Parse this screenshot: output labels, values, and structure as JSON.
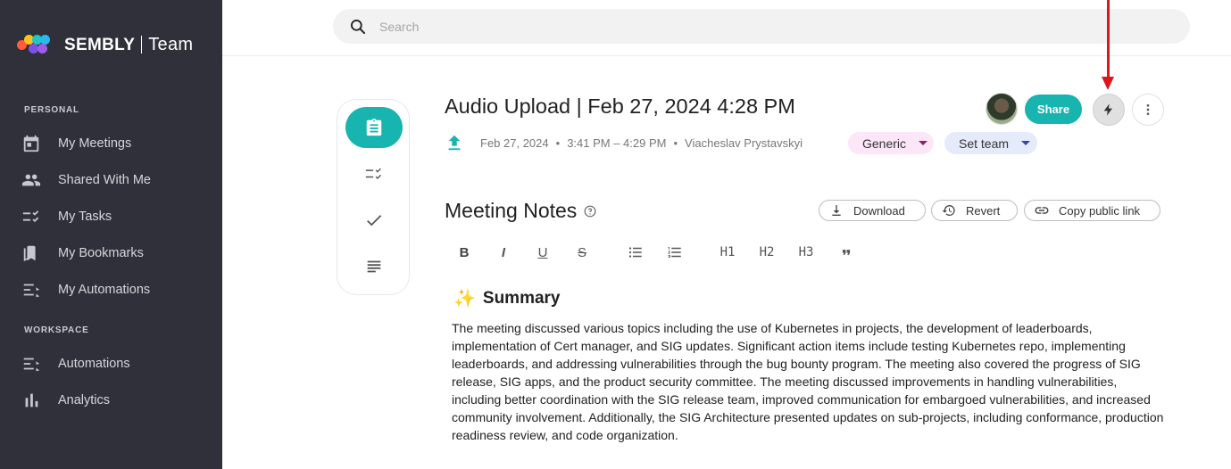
{
  "app": {
    "brand": "SEMBLY",
    "brand_suffix": "Team"
  },
  "sidebar": {
    "personal_label": "PERSONAL",
    "workspace_label": "WORKSPACE",
    "personal_items": [
      {
        "label": "My Meetings",
        "icon": "calendar-icon"
      },
      {
        "label": "Shared With Me",
        "icon": "people-icon"
      },
      {
        "label": "My Tasks",
        "icon": "tasks-icon"
      },
      {
        "label": "My Bookmarks",
        "icon": "bookmark-icon"
      },
      {
        "label": "My Automations",
        "icon": "automation-icon"
      }
    ],
    "workspace_items": [
      {
        "label": "Automations",
        "icon": "automation-icon"
      },
      {
        "label": "Analytics",
        "icon": "bar-chart-icon"
      }
    ]
  },
  "search": {
    "placeholder": "Search",
    "value": ""
  },
  "meeting": {
    "title": "Audio Upload | Feb 27, 2024 4:28 PM",
    "date": "Feb 27, 2024",
    "time_range": "3:41 PM – 4:29 PM",
    "owner": "Viacheslav Prystavskyi",
    "separator": "•",
    "type_chip": "Generic",
    "team_chip": "Set team",
    "share_label": "Share"
  },
  "notes": {
    "title": "Meeting Notes",
    "download_label": "Download",
    "revert_label": "Revert",
    "copy_link_label": "Copy public link",
    "format_toolbar": [
      "B",
      "I",
      "U",
      "S",
      "bulleted-list",
      "numbered-list",
      "H1",
      "H2",
      "H3",
      "quote"
    ],
    "summary_emoji": "✨",
    "summary_heading": "Summary",
    "summary_text": "The meeting discussed various topics including the use of Kubernetes in projects, the development of leaderboards, implementation of Cert manager, and SIG updates. Significant action items include testing Kubernetes repo, implementing leaderboards, and addressing vulnerabilities through the bug bounty program. The meeting also covered the progress of SIG release, SIG apps, and the product security committee. The meeting discussed improvements in handling vulnerabilities, including better coordination with the SIG release team, improved communication for embargoed vulnerabilities, and increased community involvement. Additionally, the SIG Architecture presented updates on sub-projects, including conformance, production readiness review, and code organization."
  },
  "colors": {
    "sidebar_bg": "#2f3039",
    "accent": "#18b4b0",
    "generic_chip_bg": "#fde6f7",
    "team_chip_bg": "#e6ebfb",
    "annotation_arrow": "#e0141c"
  }
}
